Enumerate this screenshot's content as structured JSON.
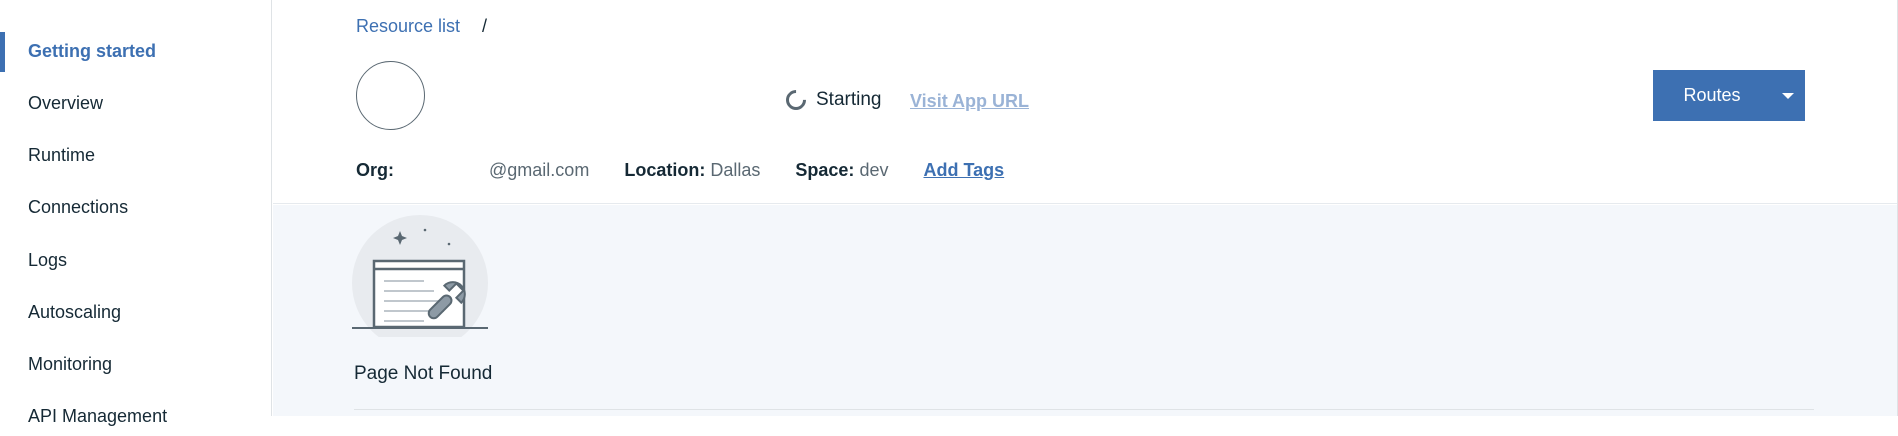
{
  "sidebar": {
    "items": [
      {
        "label": "Getting started",
        "active": true
      },
      {
        "label": "Overview"
      },
      {
        "label": "Runtime"
      },
      {
        "label": "Connections"
      },
      {
        "label": "Logs"
      },
      {
        "label": "Autoscaling"
      },
      {
        "label": "Monitoring"
      },
      {
        "label": "API Management"
      }
    ]
  },
  "header": {
    "breadcrumb": {
      "link": "Resource list",
      "separator": "/"
    },
    "status": "Starting",
    "visit_link": "Visit App URL",
    "routes_button": "Routes",
    "meta": {
      "org_label": "Org:",
      "org_value": "@gmail.com",
      "location_label": "Location:",
      "location_value": "Dallas",
      "space_label": "Space:",
      "space_value": "dev",
      "add_tags": "Add Tags"
    }
  },
  "content": {
    "empty_state": "Page Not Found",
    "illustration_icon": "wrench-window-icon"
  },
  "colors": {
    "accent": "#3d70b2",
    "text": "#152935",
    "muted": "#5a6872",
    "link_disabled": "#9ab3d6",
    "content_bg": "#f4f7fb"
  }
}
